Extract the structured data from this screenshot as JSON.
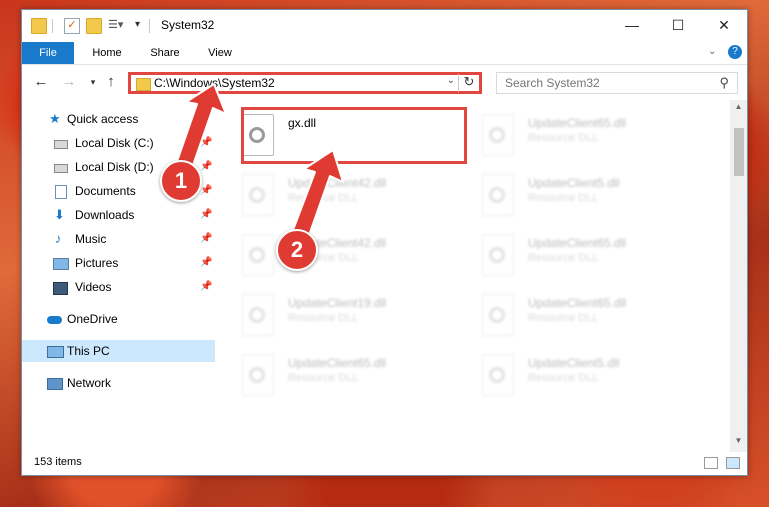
{
  "window": {
    "title": "System32",
    "controls": {
      "minimize": "—",
      "maximize": "☐",
      "close": "✕"
    }
  },
  "ribbon": {
    "tabs": [
      "File",
      "Home",
      "Share",
      "View"
    ]
  },
  "address": {
    "path": "C:\\Windows\\System32",
    "search_placeholder": "Search System32"
  },
  "nav": {
    "items": [
      {
        "label": "Quick access",
        "icon": "star-icon",
        "pinned": false
      },
      {
        "label": "Local Disk (C:)",
        "icon": "drive-icon",
        "pinned": true
      },
      {
        "label": "Local Disk (D:)",
        "icon": "drive-icon",
        "pinned": true
      },
      {
        "label": "Documents",
        "icon": "documents-icon",
        "pinned": true
      },
      {
        "label": "Downloads",
        "icon": "downloads-icon",
        "pinned": true
      },
      {
        "label": "Music",
        "icon": "music-icon",
        "pinned": true
      },
      {
        "label": "Pictures",
        "icon": "pictures-icon",
        "pinned": true
      },
      {
        "label": "Videos",
        "icon": "videos-icon",
        "pinned": true
      },
      {
        "label": "OneDrive",
        "icon": "onedrive-icon",
        "pinned": false
      },
      {
        "label": "This PC",
        "icon": "this-pc-icon",
        "pinned": false,
        "selected": true
      },
      {
        "label": "Network",
        "icon": "network-icon",
        "pinned": false
      }
    ]
  },
  "files": [
    {
      "name": "gx.dll",
      "type": "",
      "highlighted": true
    },
    {
      "name": "UpdateClient65.dll",
      "type": "Resource DLL"
    },
    {
      "name": "UpdateClient42.dll",
      "type": "Resource DLL"
    },
    {
      "name": "UpdateClient5.dll",
      "type": "Resource DLL"
    },
    {
      "name": "UpdateClient42.dll",
      "type": "Resource DLL"
    },
    {
      "name": "UpdateClient65.dll",
      "type": "Resource DLL"
    },
    {
      "name": "UpdateClient19.dll",
      "type": "Resource DLL"
    },
    {
      "name": "UpdateClient65.dll",
      "type": "Resource DLL"
    },
    {
      "name": "UpdateClient65.dll",
      "type": "Resource DLL"
    },
    {
      "name": "UpdateClient5.dll",
      "type": "Resource DLL"
    }
  ],
  "status": {
    "item_count": "153 items"
  },
  "annotations": {
    "step1": "1",
    "step2": "2",
    "color": "#e03b33"
  }
}
